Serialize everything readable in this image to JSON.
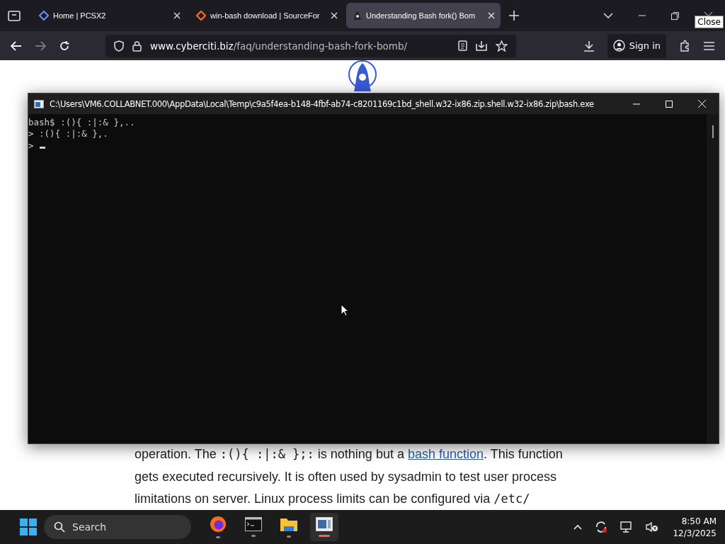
{
  "tabs": [
    {
      "title": "Home | PCSX2",
      "selected": false
    },
    {
      "title": "win-bash download | SourceFor",
      "selected": false
    },
    {
      "title": "Understanding Bash fork() Bom",
      "selected": true
    }
  ],
  "address": {
    "host": "www.cyberciti.biz",
    "path": "/faq/understanding-bash-fork-bomb/"
  },
  "sign_in": "Sign in",
  "tooltip": "Close",
  "page": {
    "lines": [
      {
        "parts": [
          {
            "text": "operation. The ",
            "kind": "text"
          },
          {
            "text": ":(){ :|:& };:",
            "kind": "code"
          },
          {
            "text": " is nothing but a ",
            "kind": "text"
          },
          {
            "text": "bash function",
            "kind": "link"
          },
          {
            "text": ". This function",
            "kind": "text"
          }
        ]
      },
      {
        "parts": [
          {
            "text": "gets executed recursively. It is often used by sysadmin to test user process",
            "kind": "text"
          }
        ]
      },
      {
        "parts": [
          {
            "text": "limitations on server. Linux process limits can be configured via ",
            "kind": "text"
          },
          {
            "text": "/etc/",
            "kind": "code"
          }
        ]
      }
    ]
  },
  "console": {
    "title": "C:\\Users\\VM6.COLLABNET.000\\AppData\\Local\\Temp\\c9a5f4ea-b148-4fbf-ab74-c8201169c1bd_shell.w32-ix86.zip.shell.w32-ix86.zip\\bash.exe",
    "lines": [
      "bash$ :(){ :|:& },..",
      "> :(){ :|:& },.",
      ">"
    ]
  },
  "taskbar": {
    "search": "Search",
    "apps": [
      {
        "kind": "firefox",
        "selected": false
      },
      {
        "kind": "terminal",
        "selected": false
      },
      {
        "kind": "folder",
        "selected": false
      },
      {
        "kind": "console",
        "selected": true
      }
    ],
    "time": "8:50 AM",
    "date": "12/3/2025"
  }
}
